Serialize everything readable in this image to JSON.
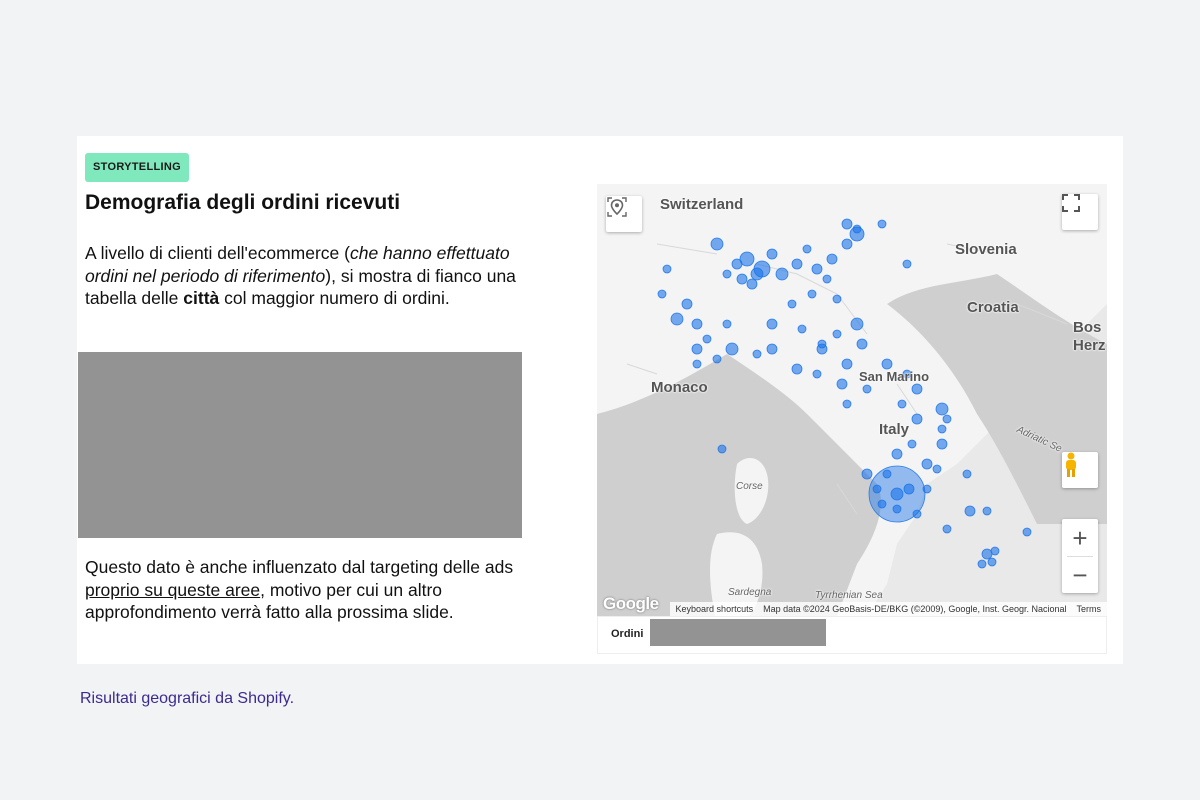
{
  "badge": "STORYTELLING",
  "title": "Demografia degli ordini ricevuti",
  "paragraph1": {
    "t1": "A livello di clienti dell'ecommerce (",
    "t2": "che hanno effettuato ordini nel periodo di riferimento",
    "t3": "), si mostra di fianco una tabella delle ",
    "t4": "città",
    "t5": " col maggior numero di ordini."
  },
  "paragraph2": {
    "t1": "Questo dato è anche influenzato dal targeting delle ads ",
    "t2": "proprio su queste aree",
    "t3": ", motivo per cui un altro approfondimento verrà fatto alla prossima slide."
  },
  "map": {
    "labels": {
      "switzerland": "Switzerland",
      "slovenia": "Slovenia",
      "croatia": "Croatia",
      "bosnia": "Bos\nHerz",
      "monaco": "Monaco",
      "san_marino": "San Marino",
      "italy": "Italy",
      "corse": "Corse",
      "sardegna": "Sardegna",
      "tyrrhenian": "Tyrrhenian Sea",
      "adriatic": "Adriatic Se"
    },
    "google": "Google",
    "attribution": {
      "shortcuts": "Keyboard shortcuts",
      "data": "Map data ©2024 GeoBasis-DE/BKG (©2009), Google, Inst. Geogr. Nacional",
      "terms": "Terms"
    },
    "controls": {
      "zoom_in": "+",
      "zoom_out": "−"
    },
    "marker_color": "#1a73e8"
  },
  "legend_label": "Ordini",
  "caption": "Risultati geografici da Shopify."
}
